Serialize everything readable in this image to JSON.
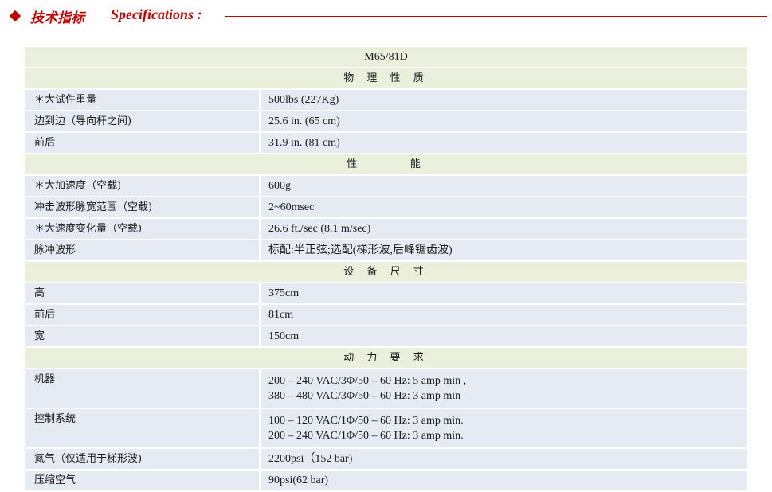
{
  "header": {
    "title_cn": "技术指标",
    "title_en": "Specifications :"
  },
  "model": "M65/81D",
  "sections": {
    "physical": {
      "title": "物 理 性 质",
      "rows": [
        {
          "label": "＊大试件重量",
          "value": "500lbs (227Kg)"
        },
        {
          "label": "边到边（导向杆之间)",
          "value": " 25.6 in. (65 cm)"
        },
        {
          "label": "前后",
          "value": " 31.9 in. (81 cm)"
        }
      ]
    },
    "performance": {
      "title": "性      能",
      "rows": [
        {
          "label": "＊大加速度（空载)",
          "value": "600g"
        },
        {
          "label": "冲击波形脉宽范围（空载)",
          "value": "2~60msec"
        },
        {
          "label": "＊大速度变化量（空载)",
          "value": "26.6 ft./sec (8.1 m/sec)"
        },
        {
          "label": "脉冲波形",
          "value": "标配:半正弦;选配(梯形波,后峰锯齿波)"
        }
      ]
    },
    "dimensions": {
      "title": "设 备 尺 寸",
      "rows": [
        {
          "label": "高",
          "value": "375cm"
        },
        {
          "label": "前后",
          "value": "81cm"
        },
        {
          "label": "宽",
          "value": "150cm"
        }
      ]
    },
    "power": {
      "title": "动 力 要 求",
      "rows": [
        {
          "label": "机器",
          "line1": "200 – 240 VAC/3Φ/50 – 60 Hz: 5 amp min ,",
          "line2": "380 – 480 VAC/3Φ/50 – 60 Hz: 3 amp min"
        },
        {
          "label": "控制系统",
          "line1": "100 – 120 VAC/1Φ/50 – 60 Hz: 3 amp min.",
          "line2": "200 – 240 VAC/1Φ/50 – 60 Hz: 3 amp min."
        },
        {
          "label": "氮气（仅适用于梯形波)",
          "value": "2200psi（152 bar)"
        },
        {
          "label": "压缩空气",
          "value": "90psi(62 bar)"
        }
      ]
    }
  }
}
